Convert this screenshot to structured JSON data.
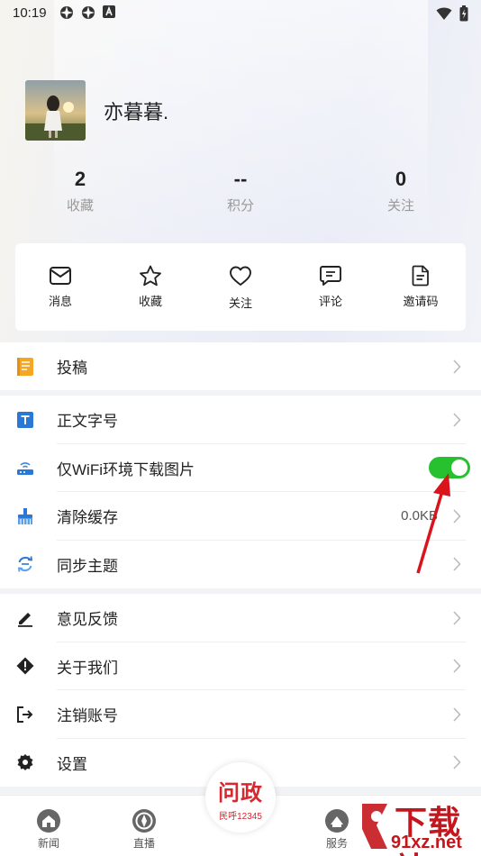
{
  "status_bar": {
    "time": "10:19"
  },
  "profile": {
    "username": "亦暮暮."
  },
  "stats": [
    {
      "value": "2",
      "label": "收藏"
    },
    {
      "value": "--",
      "label": "积分"
    },
    {
      "value": "0",
      "label": "关注"
    }
  ],
  "quick_actions": [
    {
      "label": "消息",
      "icon": "mail-icon"
    },
    {
      "label": "收藏",
      "icon": "star-icon"
    },
    {
      "label": "关注",
      "icon": "heart-icon"
    },
    {
      "label": "评论",
      "icon": "comment-icon"
    },
    {
      "label": "邀请码",
      "icon": "document-icon"
    }
  ],
  "menu": {
    "submit": {
      "label": "投稿"
    },
    "font_size": {
      "label": "正文字号"
    },
    "wifi_only": {
      "label": "仅WiFi环境下载图片",
      "enabled": true
    },
    "clear_cache": {
      "label": "清除缓存",
      "value": "0.0KB"
    },
    "sync_theme": {
      "label": "同步主题"
    },
    "feedback": {
      "label": "意见反馈"
    },
    "about": {
      "label": "关于我们"
    },
    "logout": {
      "label": "注销账号"
    },
    "settings": {
      "label": "设置"
    }
  },
  "tabbar": {
    "news": "新闻",
    "live": "直播",
    "center_title": "问政",
    "center_sub": "民呼12345",
    "service": "服务"
  },
  "watermark": {
    "line1": "下载站",
    "line2": "91xz.net"
  },
  "colors": {
    "toggle_on": "#27c12f",
    "accent_red": "#d8282f",
    "arrow": "#d9141c"
  }
}
